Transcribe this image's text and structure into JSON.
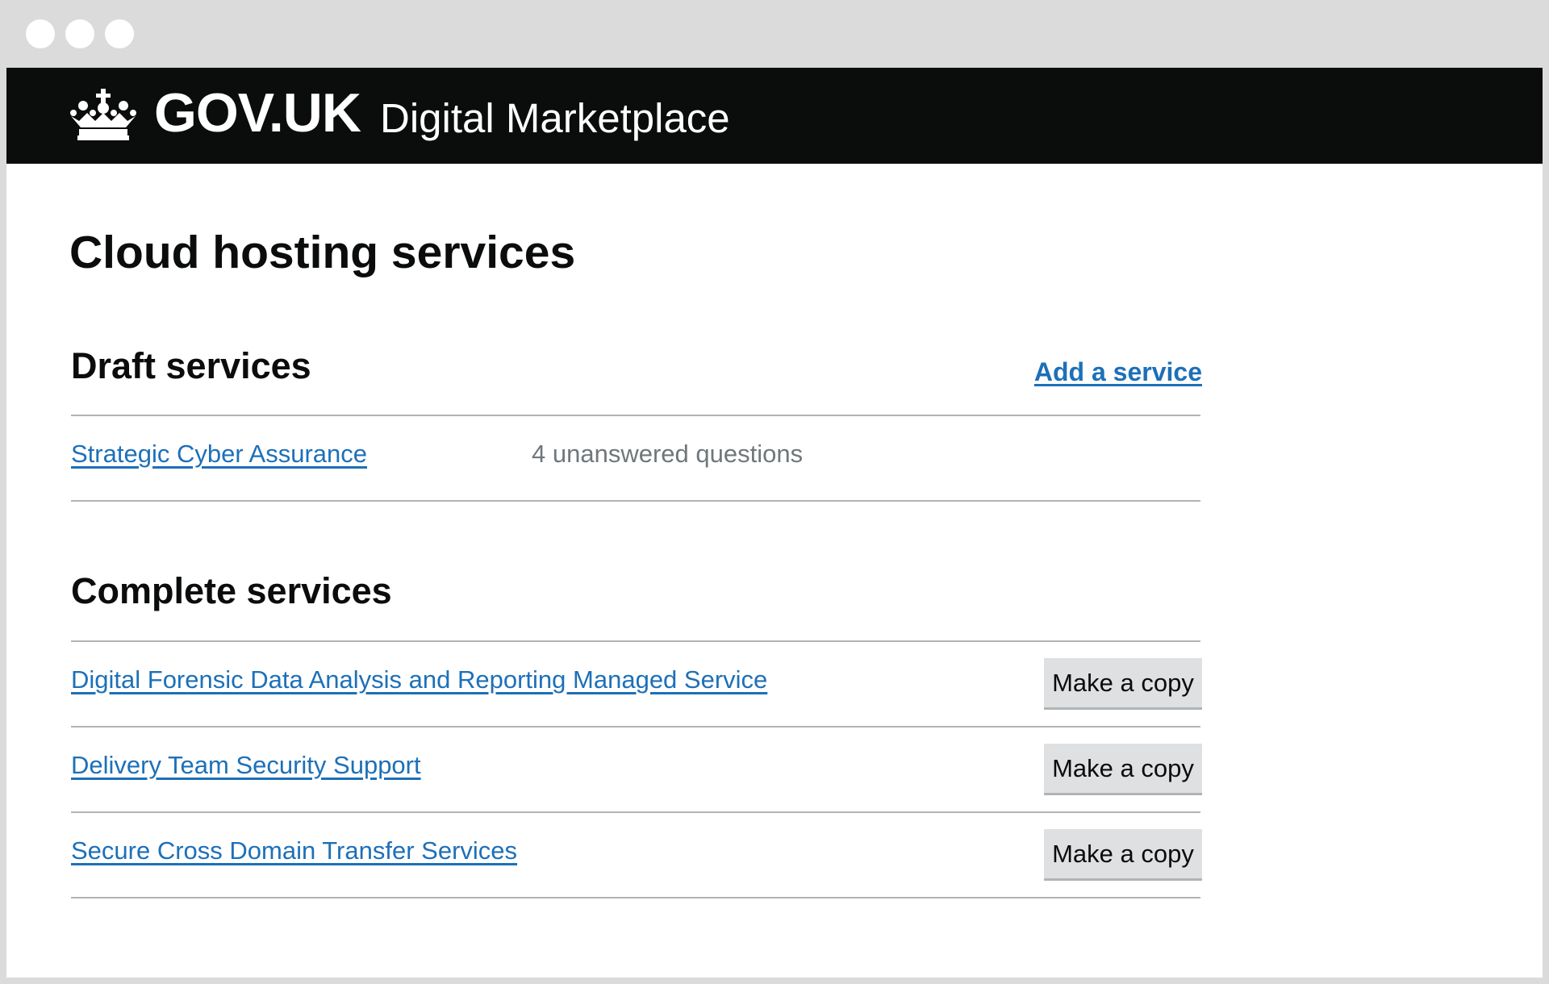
{
  "header": {
    "logo_text": "GOV.UK",
    "service_name": "Digital Marketplace",
    "crown_icon": "crown-icon",
    "background_color": "#0b0c0c"
  },
  "page": {
    "title": "Cloud hosting services"
  },
  "draft": {
    "heading": "Draft services",
    "add_link_label": "Add a service",
    "items": [
      {
        "label": "Strategic Cyber Assurance",
        "status": "4 unanswered questions"
      }
    ]
  },
  "complete": {
    "heading": "Complete services",
    "copy_button_label": "Make a copy",
    "items": [
      {
        "label": "Digital Forensic Data Analysis and Reporting Managed Service"
      },
      {
        "label": "Delivery Team Security Support"
      },
      {
        "label": "Secure Cross Domain Transfer Services"
      }
    ]
  },
  "colors": {
    "link": "#1d70b8",
    "text": "#0b0c0c",
    "secondary_text": "#6f777b",
    "button_background": "#dee0e2",
    "border": "#b1b4b6"
  }
}
